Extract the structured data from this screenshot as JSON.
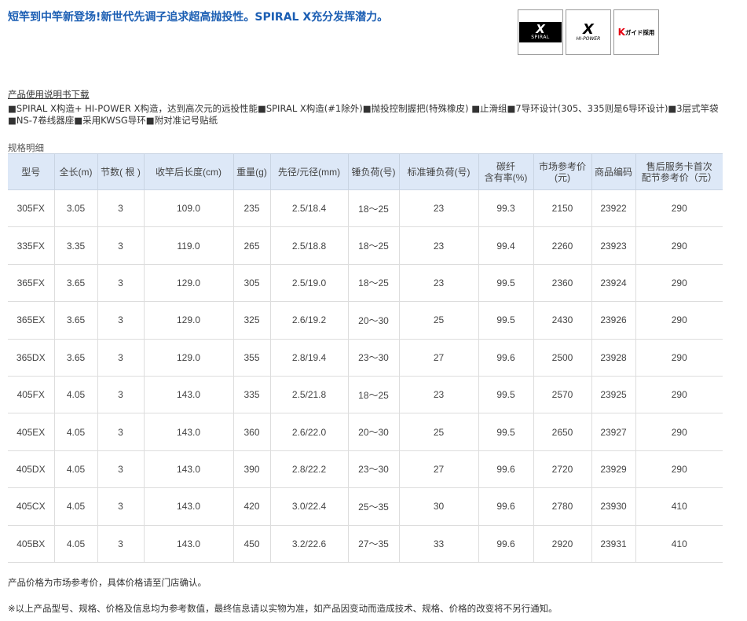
{
  "headline": "短竿到中竿新登场!新世代先调子追求超高抛投性。SPIRAL X充分发挥潜力。",
  "logos": {
    "spiral_x": {
      "mark": "X",
      "text": "SPIRAL"
    },
    "hi_power": {
      "mark": "X",
      "text": "HI-POWER"
    },
    "kgaido": {
      "mark": "K",
      "text": "ガイド採用",
      "accent": "#e60012"
    }
  },
  "manual_link": "产品使用说明书下载",
  "features": "■SPIRAL X构造+ HI-POWER X构造，达到高次元的远投性能■SPIRAL X构造(#1除外)■抛投控制握把(特殊橡皮) ■止滑组■7导环设计(305、335则是6导环设计)■3层式竿袋■NS-7卷线器座■采用KWSG导环■附对准记号贴纸",
  "spec_title": "规格明细",
  "table": {
    "headers": [
      "型号",
      "全长(m)",
      "节数( 根 )",
      "收竿后长度(cm)",
      "重量(g)",
      "先径/元径(mm)",
      "锤负荷(号)",
      "标准锤负荷(号)",
      "碳纤\n含有率(%)",
      "市场参考价\n(元)",
      "商品编码",
      "售后服务卡首次\n配节参考价（元）"
    ],
    "rows": [
      [
        "305FX",
        "3.05",
        "3",
        "109.0",
        "235",
        "2.5/18.4",
        "18～25",
        "23",
        "99.3",
        "2150",
        "23922",
        "290"
      ],
      [
        "335FX",
        "3.35",
        "3",
        "119.0",
        "265",
        "2.5/18.8",
        "18～25",
        "23",
        "99.4",
        "2260",
        "23923",
        "290"
      ],
      [
        "365FX",
        "3.65",
        "3",
        "129.0",
        "305",
        "2.5/19.0",
        "18～25",
        "23",
        "99.5",
        "2360",
        "23924",
        "290"
      ],
      [
        "365EX",
        "3.65",
        "3",
        "129.0",
        "325",
        "2.6/19.2",
        "20～30",
        "25",
        "99.5",
        "2430",
        "23926",
        "290"
      ],
      [
        "365DX",
        "3.65",
        "3",
        "129.0",
        "355",
        "2.8/19.4",
        "23～30",
        "27",
        "99.6",
        "2500",
        "23928",
        "290"
      ],
      [
        "405FX",
        "4.05",
        "3",
        "143.0",
        "335",
        "2.5/21.8",
        "18～25",
        "23",
        "99.5",
        "2570",
        "23925",
        "290"
      ],
      [
        "405EX",
        "4.05",
        "3",
        "143.0",
        "360",
        "2.6/22.0",
        "20～30",
        "25",
        "99.5",
        "2650",
        "23927",
        "290"
      ],
      [
        "405DX",
        "4.05",
        "3",
        "143.0",
        "390",
        "2.8/22.2",
        "23～30",
        "27",
        "99.6",
        "2720",
        "23929",
        "290"
      ],
      [
        "405CX",
        "4.05",
        "3",
        "143.0",
        "420",
        "3.0/22.4",
        "25～35",
        "30",
        "99.6",
        "2780",
        "23930",
        "410"
      ],
      [
        "405BX",
        "4.05",
        "3",
        "143.0",
        "450",
        "3.2/22.6",
        "27～35",
        "33",
        "99.6",
        "2920",
        "23931",
        "410"
      ]
    ]
  },
  "notes": [
    "产品价格为市场参考价，具体价格请至门店确认。",
    "※以上产品型号、规格、价格及信息均为参考数值，最终信息请以实物为准，如产品因变动而造成技术、规格、价格的改变将不另行通知。"
  ],
  "colors": {
    "headline": "#1b5eb3",
    "table_header_bg": "#dde8f7",
    "brand_red": "#e60012"
  }
}
